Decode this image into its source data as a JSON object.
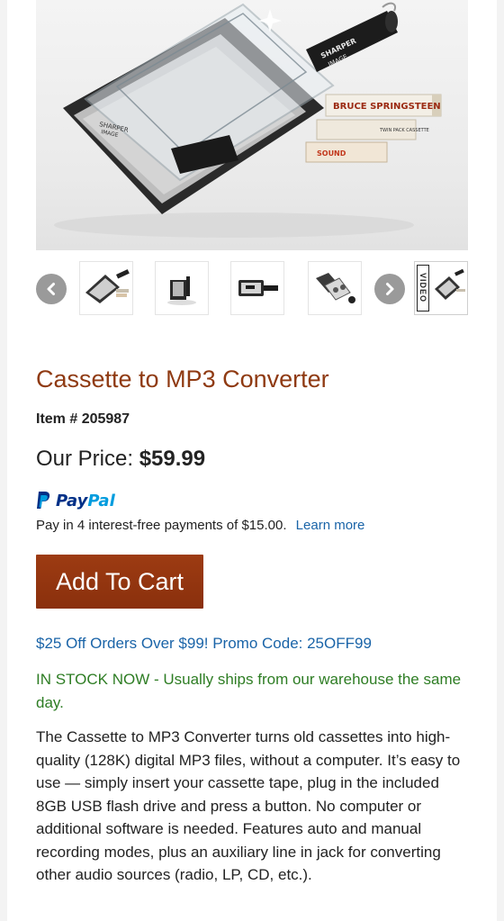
{
  "hero": {
    "brand_text_line1": "SHARPER",
    "brand_text_line2": "IMAGE",
    "tape1": "BRUCE SPRINGSTEEN",
    "tape2": "TWIN PACK CASSETTE",
    "tape3": "SOUND",
    "device_brand_line1": "SHARPER",
    "device_brand_line2": "IMAGE"
  },
  "thumbs": {
    "video_label": "VIDEO"
  },
  "product": {
    "title": "Cassette to MP3 Converter",
    "item_number": "Item # 205987",
    "price_label": "Our Price:",
    "price_value": "$59.99"
  },
  "paypal": {
    "wordmark_a": "Pay",
    "wordmark_b": "Pal",
    "installment_text": "Pay in 4 interest-free payments of $15.00.",
    "learn_more": "Learn more"
  },
  "cart": {
    "button_label": "Add To Cart"
  },
  "promo": {
    "text": "$25 Off Orders Over $99! Promo Code: 25OFF99"
  },
  "stock": {
    "text": "IN STOCK NOW - Usually ships from our warehouse the same day."
  },
  "description": {
    "text": "The Cassette to MP3 Converter turns old cassettes into high-quality (128K) digital MP3 files, without a computer. It’s easy to use — simply insert your cassette tape, plug in the included 8GB USB flash drive and press a button. No computer or additional software is needed. Features auto and manual recording modes, plus an auxiliary line in jack for converting other audio sources (radio, LP, CD, etc.)."
  },
  "colors": {
    "title": "#8f3a12",
    "cart_button": "#9d3b12",
    "link": "#1a64a8",
    "stock": "#2e7d24"
  }
}
